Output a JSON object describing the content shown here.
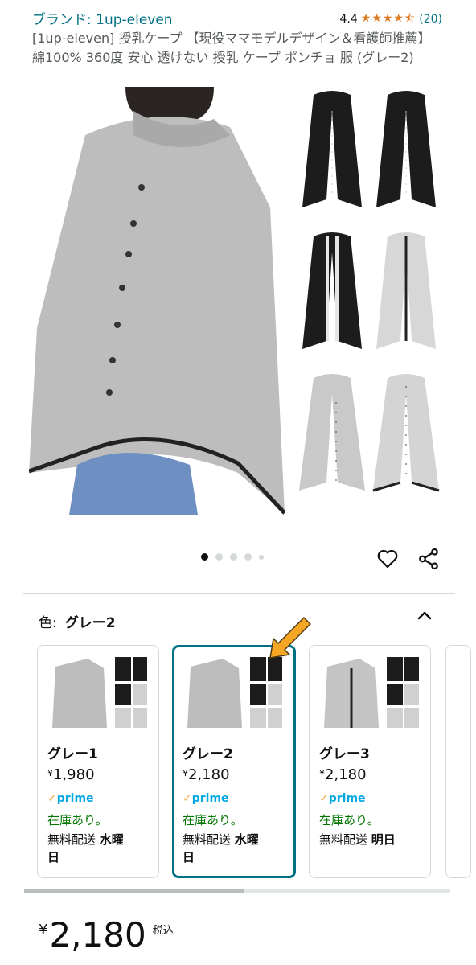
{
  "product": {
    "brand_link": "ブランド: 1up-eleven",
    "rating": "4.4",
    "stars": "★★★★⯪",
    "rating_count": "(20)",
    "title": "[1up-eleven] 授乳ケープ 【現役ママモデルデザイン＆看護師推薦】 綿100% 360度 安心 透けない 授乳 ケープ ポンチョ 服 (グレー2)"
  },
  "gallery": {
    "main_image_alt": "grey nursing poncho worn by model",
    "thumb_count": 6,
    "dots": 5,
    "active_dot": 0
  },
  "actions": {
    "favorite_icon": "heart-icon",
    "share_icon": "share-icon"
  },
  "color_selector": {
    "label": "色:",
    "selected": "グレー2",
    "expand_icon": "chevron-up-icon"
  },
  "variants": [
    {
      "name": "グレー1",
      "currency": "¥",
      "price": "1,980",
      "prime_check": "✓",
      "prime": "prime",
      "stock": "在庫あり。",
      "ship_prefix": "無料配送",
      "ship_day": "水曜日",
      "ship_day_a": "水曜",
      "ship_day_b": "日"
    },
    {
      "name": "グレー2",
      "currency": "¥",
      "price": "2,180",
      "prime_check": "✓",
      "prime": "prime",
      "stock": "在庫あり。",
      "ship_prefix": "無料配送",
      "ship_day": "水曜日",
      "ship_day_a": "水曜",
      "ship_day_b": "日"
    },
    {
      "name": "グレー3",
      "currency": "¥",
      "price": "2,180",
      "prime_check": "✓",
      "prime": "prime",
      "stock": "在庫あり。",
      "ship_prefix": "無料配送",
      "ship_day": "明日",
      "ship_day_a": "明日",
      "ship_day_b": ""
    }
  ],
  "price": {
    "currency": "¥",
    "amount": "2,180",
    "tax_label": "税込"
  },
  "colors": {
    "link": "#007185",
    "star": "#DE7921",
    "prime": "#00A8E1",
    "stock": "#007600",
    "selected_border": "#007185",
    "arrow": "#F5A623"
  }
}
